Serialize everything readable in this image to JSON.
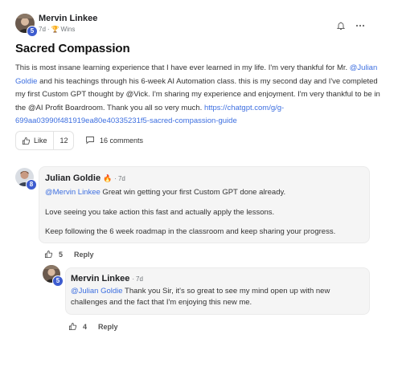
{
  "post": {
    "author": "Mervin Linkee",
    "level": "5",
    "time": "7d",
    "category": "Wins",
    "title": "Sacred Compassion",
    "body_pre": "This is most insane learning experience that I have ever learned in my life. I'm very thankful for Mr. ",
    "body_mention": "@Julian Goldie",
    "body_mid": " and his teachings through his 6-week AI Automation class. this is my second day and I've completed my first Custom GPT thought by @Vick. I'm sharing my experience and enjoyment. I'm very thankful to be in the @AI Profit Boardroom. Thank you all so very much. ",
    "body_link": "https://chatgpt.com/g/g-699aa03990f481919ea80e40335231f5-sacred-compassion-guide",
    "like_label": "Like",
    "like_count": "12",
    "comments_label": "16 comments"
  },
  "comments": [
    {
      "author": "Julian Goldie",
      "flame": "🔥",
      "level": "8",
      "time": "7d",
      "mention": "@Mervin Linkee",
      "line1": " Great win getting your first Custom GPT done already.",
      "line2": "Love seeing you take action this fast and actually apply the lessons.",
      "line3": "Keep following the 6 week roadmap in the classroom and keep sharing your progress.",
      "likes": "5",
      "reply_label": "Reply"
    },
    {
      "author": "Mervin Linkee",
      "level": "5",
      "time": "7d",
      "mention": "@Julian Goldie",
      "text": " Thank you Sir, it's so great to see my mind open up with new challenges and the fact that I'm enjoying this new me.",
      "likes": "4",
      "reply_label": "Reply"
    }
  ],
  "colors": {
    "link": "#3d6fe0",
    "level_badge": "#3d5ccf",
    "bubble": "#f5f5f5"
  }
}
